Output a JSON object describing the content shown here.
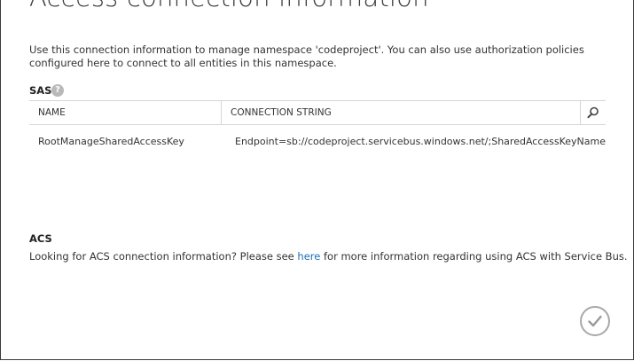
{
  "dialog": {
    "title": "Access connection information",
    "description": "Use this connection information to manage namespace 'codeproject'. You can also use authorization policies configured here to connect to all entities in this namespace."
  },
  "sas": {
    "label": "SAS",
    "help_icon": "question-circle-icon",
    "columns": [
      "NAME",
      "CONNECTION STRING"
    ],
    "search_icon": "magnifier-icon",
    "rows": [
      {
        "name": "RootManageSharedAccessKey",
        "connection_string": "Endpoint=sb://codeproject.servicebus.windows.net/;SharedAccessKeyName=Roo"
      }
    ]
  },
  "acs": {
    "label": "ACS",
    "text_before": "Looking for ACS connection information? Please see ",
    "link_text": "here",
    "text_after": " for more information regarding using ACS with Service Bus."
  },
  "ok_button": {
    "icon": "checkmark-icon"
  },
  "colors": {
    "link": "#1e6fb7",
    "border": "#d6d6d6",
    "ok_button_border": "#a8a8a8"
  }
}
